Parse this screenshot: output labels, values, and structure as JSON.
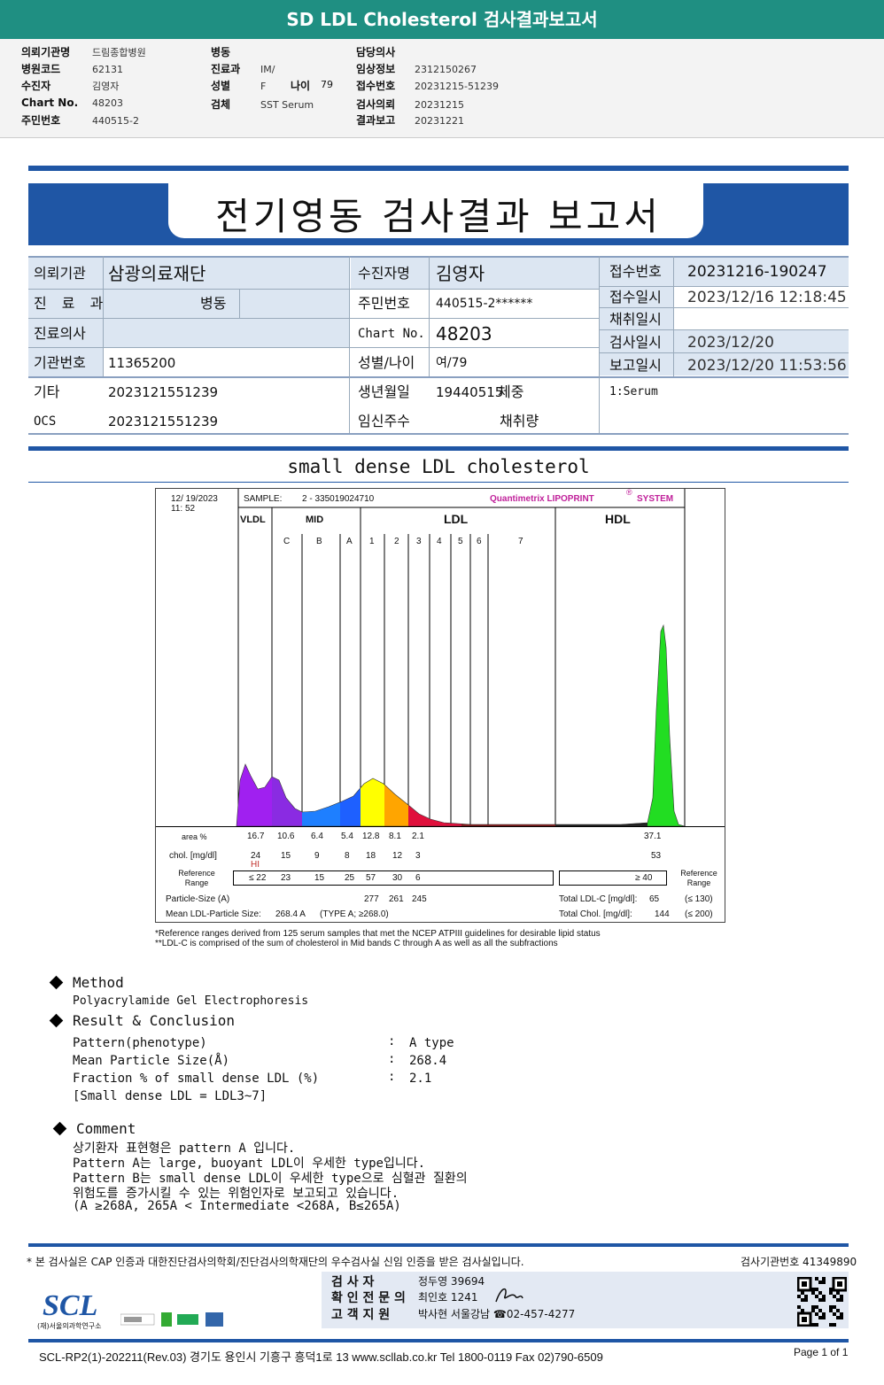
{
  "header": {
    "title": "SD LDL Cholesterol 검사결과보고서"
  },
  "summary": {
    "col1": [
      [
        "의뢰기관명",
        "드림종합병원"
      ],
      [
        "병원코드",
        "62131"
      ],
      [
        "수진자",
        "김영자"
      ],
      [
        "Chart No.",
        "48203"
      ],
      [
        "주민번호",
        "440515-2"
      ]
    ],
    "col2": [
      [
        "병동",
        ""
      ],
      [
        "진료과",
        "IM/"
      ],
      [
        "성별",
        "F"
      ],
      [
        "검체",
        "SST Serum"
      ]
    ],
    "age_label": "나이",
    "age": "79",
    "col3": [
      [
        "담당의사",
        ""
      ],
      [
        "임상정보",
        "2312150267"
      ],
      [
        "접수번호",
        "20231215-51239"
      ],
      [
        "검사의뢰",
        "20231215"
      ],
      [
        "결과보고",
        "20231221"
      ]
    ]
  },
  "report": {
    "title": "전기영동 검사결과 보고서"
  },
  "info": {
    "inst_label": "의뢰기관",
    "inst": "삼광의료재단",
    "dept_label": "진 료 과",
    "ward_label": "병동",
    "doctor_label": "진료의사",
    "inst_no_label": "기관번호",
    "inst_no": "11365200",
    "etc_label": "기타",
    "etc": "2023121551239",
    "ocs_label": "OCS",
    "ocs": "2023121551239",
    "patient_label": "수진자명",
    "patient": "김영자",
    "rrn_label": "주민번호",
    "rrn": "440515-2******",
    "chart_label": "Chart No.",
    "chart": "48203",
    "sexage_label": "성별/나이",
    "sexage": "여/79",
    "birth_label": "생년월일",
    "birth": "19440515",
    "weight_label": "체중",
    "preg_label": "임신주수",
    "volume_label": "채취량",
    "acc_no_label": "접수번호",
    "acc_no": "20231216-190247",
    "acc_dt_label": "접수일시",
    "acc_dt": "2023/12/16 12:18:45",
    "col_dt_label": "채취일시",
    "col_dt": "",
    "test_dt_label": "검사일시",
    "test_dt": "2023/12/20",
    "rep_dt_label": "보고일시",
    "rep_dt": "2023/12/20 11:53:56",
    "specimen": "1:Serum"
  },
  "section_title": "small dense LDL cholesterol",
  "lipoprint": {
    "date": "12/ 19/2023",
    "time": "11: 52",
    "sample_label": "SAMPLE:",
    "sample": "2 - 335019024710",
    "brand": "Quantimetrix LIPOPRINT",
    "brand_mark": "®",
    "brand_suffix": "SYSTEM",
    "groups": [
      "VLDL",
      "MID",
      "LDL",
      "HDL"
    ],
    "bands": [
      "C",
      "B",
      "A",
      "1",
      "2",
      "3",
      "4",
      "5",
      "6",
      "7"
    ],
    "area_label": "area %",
    "area": [
      "16.7",
      "10.6",
      "6.4",
      "5.4",
      "12.8",
      "8.1",
      "2.1"
    ],
    "hdl_area": "37.1",
    "chol_label": "chol. [mg/dl]",
    "chol": [
      "24",
      "15",
      "9",
      "8",
      "18",
      "12",
      "3"
    ],
    "hdl_chol": "53",
    "flag": "HI",
    "ref_label": "Reference Range",
    "ref": [
      "≤ 22",
      "23",
      "15",
      "25",
      "57",
      "30",
      "6"
    ],
    "hdl_ref": "≥  40",
    "size_label": "Particle-Size (A)",
    "sizes": [
      "277",
      "261",
      "245"
    ],
    "mean_label": "Mean LDL-Particle Size:",
    "mean": "268.4  A",
    "mean_type": "(TYPE A; ≥268.0)",
    "ldlc_label": "Total LDL-C  [mg/dl]:",
    "ldlc": "65",
    "ldlc_ref": "(≤ 130)",
    "tchol_label": "Total Chol.  [mg/dl]:",
    "tchol": "144",
    "tchol_ref": "(≤ 200)",
    "note1": "*Reference ranges derived from 125 serum samples that met the NCEP ATPIII guidelines for desirable lipid status",
    "note2": "**LDL-C is comprised of the sum of cholesterol in Mid bands C through A as well as all the subfractions",
    "colors": {
      "vldl": "#a020f0",
      "mid_c": "#8a2be2",
      "mid_b": "#1e7fff",
      "mid_a": "#1e60ff",
      "ldl1": "#ffff00",
      "ldl2": "#ffa500",
      "ldl3": "#e0103c",
      "hdl": "#22dd22"
    }
  },
  "method": {
    "title": "Method",
    "text": "Polyacrylamide Gel Electrophoresis"
  },
  "result": {
    "title": "Result & Conclusion",
    "rows": [
      [
        "Pattern(phenotype)",
        "A type"
      ],
      [
        "Mean Particle Size(Å)",
        "268.4"
      ],
      [
        "Fraction % of small dense LDL (%)",
        "2.1"
      ]
    ],
    "note": "[Small dense LDL = LDL3~7]"
  },
  "comment": {
    "title": "Comment",
    "lines": [
      "상기환자 표현형은 pattern A 입니다.",
      "Pattern A는 large, buoyant LDL이 우세한 type입니다.",
      "Pattern B는 small dense LDL이 우세한 type으로 심혈관 질환의",
      "위험도를 증가시킬 수 있는 위험인자로 보고되고 있습니다.",
      "(A ≥268A, 265A < Intermediate <268A, B≤265A)"
    ]
  },
  "footer": {
    "cert": "* 본 검사실은 CAP 인증과 대한진단검사의학회/진단검사의학재단의 우수검사실 신임 인증을 받은 검사실입니다.",
    "lab_no": "검사기관번호 41349890",
    "tester_label": "검   사   자",
    "tester": "정두영 39694",
    "confirm_label": "확 인 전 문 의",
    "confirm": "최인호 1241",
    "support_label": "고  객  지  원",
    "support": "박사현 서울강남 ☎02-457-4277",
    "logo": "SCL",
    "logo_sub": "(재)서울의과학연구소",
    "address": "SCL-RP2(1)-202211(Rev.03)  경기도 용인시 기흥구 흥덕1로 13  www.scllab.co.kr   Tel 1800-0119    Fax 02)790-6509",
    "page": "Page 1 of 1"
  }
}
